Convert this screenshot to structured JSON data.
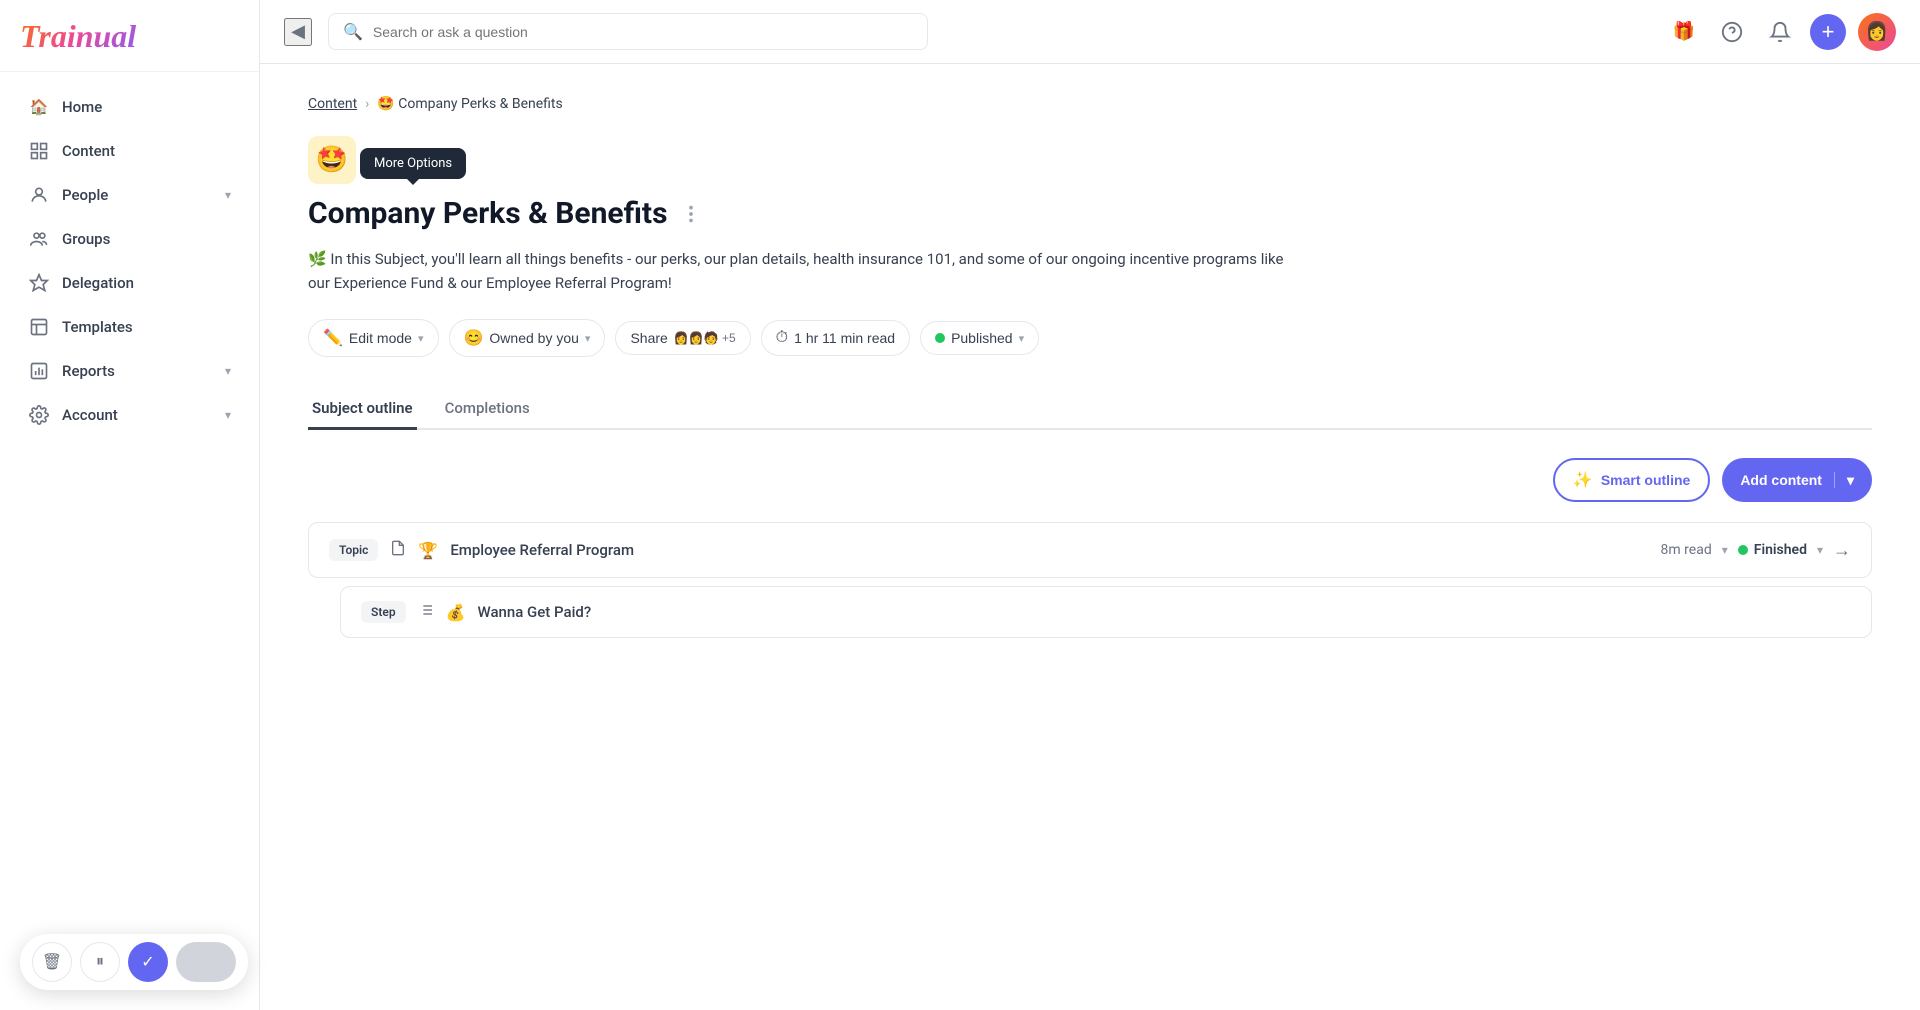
{
  "app": {
    "name": "Trainual"
  },
  "topbar": {
    "search_placeholder": "Search or ask a question",
    "collapse_icon": "◀",
    "gift_icon": "🎁",
    "help_icon": "?",
    "bell_icon": "🔔",
    "plus_icon": "+",
    "avatar_emoji": "👩"
  },
  "sidebar": {
    "items": [
      {
        "label": "Home",
        "icon": "🏠",
        "has_chevron": false
      },
      {
        "label": "Content",
        "icon": "📋",
        "has_chevron": false
      },
      {
        "label": "People",
        "icon": "👤",
        "has_chevron": true
      },
      {
        "label": "Groups",
        "icon": "👥",
        "has_chevron": false
      },
      {
        "label": "Delegation",
        "icon": "💠",
        "has_chevron": false
      },
      {
        "label": "Templates",
        "icon": "📄",
        "has_chevron": false
      },
      {
        "label": "Reports",
        "icon": "📊",
        "has_chevron": true
      },
      {
        "label": "Account",
        "icon": "⚙️",
        "has_chevron": true
      }
    ]
  },
  "bottom_toolbar": {
    "delete_icon": "🗑",
    "pause_icon": "⏸",
    "check_icon": "✓"
  },
  "breadcrumb": {
    "parent_label": "Content",
    "separator": "›",
    "current_label": "🤩 Company Perks & Benefits"
  },
  "subject": {
    "emoji": "🤩",
    "title": "Company Perks & Benefits",
    "more_options_tooltip": "More Options",
    "description": "🌿 In this Subject, you'll learn all things benefits - our perks, our plan details, health insurance 101, and some of our ongoing incentive programs like our Experience Fund & our Employee Referral Program!"
  },
  "subject_toolbar": {
    "edit_mode_label": "Edit mode",
    "owned_by_label": "Owned by you",
    "share_label": "Share",
    "avatars_count": "+5",
    "read_time": "1 hr 11 min read",
    "status_label": "Published"
  },
  "tabs": [
    {
      "label": "Subject outline",
      "active": true
    },
    {
      "label": "Completions",
      "active": false
    }
  ],
  "content_actions": {
    "smart_outline_label": "Smart outline",
    "add_content_label": "Add content"
  },
  "outline": {
    "topic": {
      "badge": "Topic",
      "emoji": "🏆",
      "title": "Employee Referral Program",
      "read_time": "8m read",
      "status_label": "Finished"
    },
    "step": {
      "badge": "Step",
      "emoji": "💰",
      "title": "Wanna Get Paid?"
    }
  }
}
